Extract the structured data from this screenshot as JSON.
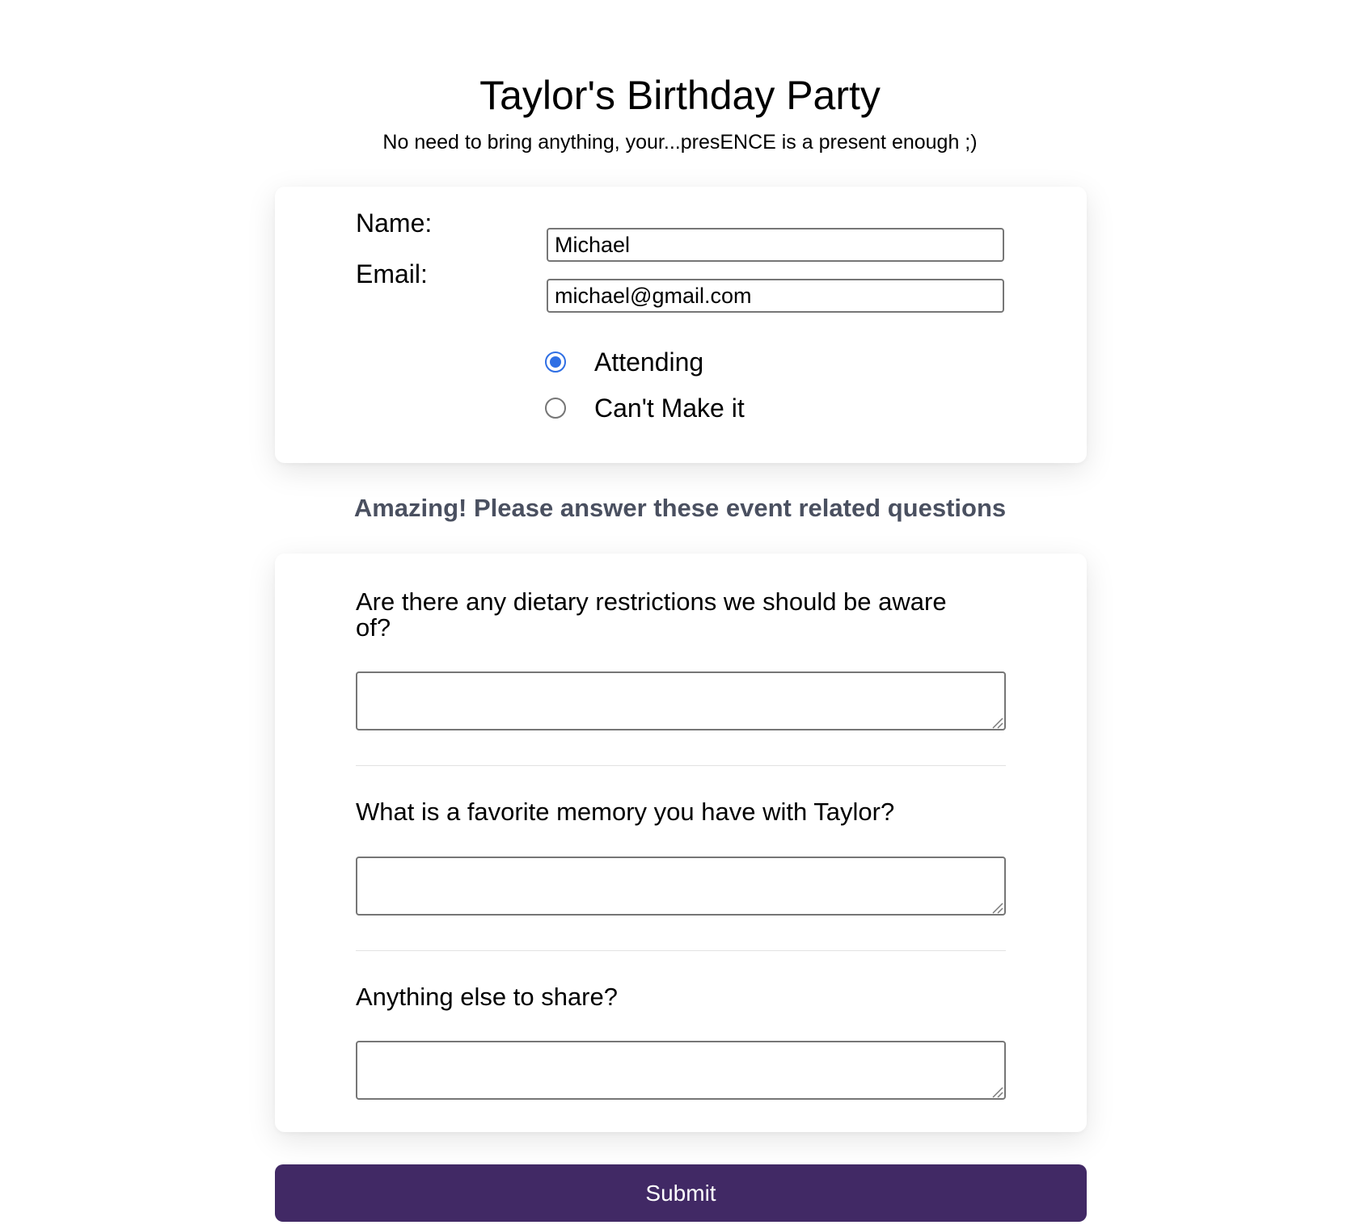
{
  "header": {
    "title": "Taylor's Birthday Party",
    "subtitle": "No need to bring anything, your...presENCE is a present enough ;)"
  },
  "contact": {
    "name_label": "Name:",
    "name_value": "Michael",
    "email_label": "Email:",
    "email_value": "michael@gmail.com",
    "attendance": {
      "options": [
        {
          "label": "Attending",
          "checked": true
        },
        {
          "label": "Can't Make it",
          "checked": false
        }
      ]
    }
  },
  "questions_section": {
    "heading": "Amazing! Please answer these event related questions",
    "questions": [
      {
        "text": "Are there any dietary restrictions we should be aware of?",
        "answer": ""
      },
      {
        "text": "What is a favorite memory you have with Taylor?",
        "answer": ""
      },
      {
        "text": "Anything else to share?",
        "answer": ""
      }
    ]
  },
  "submit_label": "Submit",
  "colors": {
    "accent": "#412965",
    "radio_selected": "#2f6fe4",
    "section_heading": "#4a5060"
  }
}
